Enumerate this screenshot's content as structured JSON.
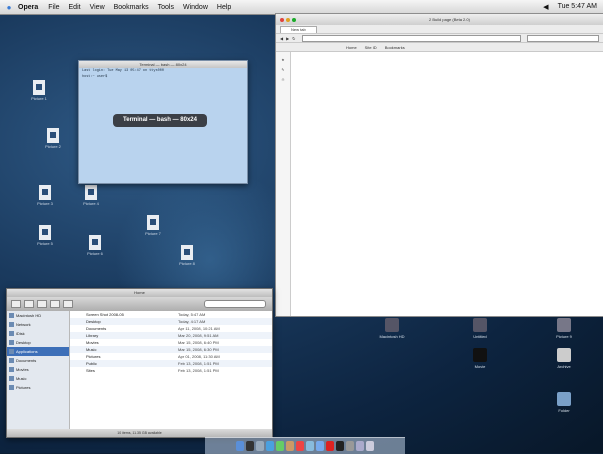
{
  "menubar": {
    "app": "Opera",
    "items": [
      "File",
      "Edit",
      "View",
      "Bookmarks",
      "Tools",
      "Window",
      "Help"
    ],
    "clock": "Tue 5:47 AM"
  },
  "terminal": {
    "title": "Terminal — bash — 80x24",
    "hud": "Terminal — bash — 80x24"
  },
  "browser": {
    "title": "2 Build page (Beta 2.0)",
    "tab": "New tab",
    "bookmarks": [
      "Home",
      "Site ID",
      "Bookmarks"
    ]
  },
  "finder": {
    "sidebar": [
      "Macintosh HD",
      "Network",
      "iDisk",
      "Desktop",
      "Applications",
      "Documents",
      "Movies",
      "Music",
      "Pictures"
    ],
    "selected": "Applications",
    "rows": [
      {
        "name": "Screen Shot 2008-05",
        "date": "Today, 5:47 AM"
      },
      {
        "name": "Desktop",
        "date": "Today, 4:17 AM"
      },
      {
        "name": "Documents",
        "date": "Apr 11, 2008, 10:21 AM"
      },
      {
        "name": "Library",
        "date": "Mar 20, 2008, 9:51 AM"
      },
      {
        "name": "Movies",
        "date": "Mar 15, 2008, 6:40 PM"
      },
      {
        "name": "Music",
        "date": "Mar 15, 2008, 6:30 PM"
      },
      {
        "name": "Pictures",
        "date": "Apr 01, 2008, 11:30 AM"
      },
      {
        "name": "Public",
        "date": "Feb 13, 2008, 1:51 PM"
      },
      {
        "name": "Sites",
        "date": "Feb 13, 2008, 1:51 PM"
      }
    ],
    "status": "10 items, 11.35 GB available"
  },
  "desktop_icons": {
    "left": [
      "Picture 1",
      "Picture 2",
      "Picture 3",
      "Picture 4",
      "Picture 5",
      "Picture 6",
      "Picture 7",
      "Picture 8"
    ],
    "right": [
      "Macintosh HD",
      "Untitled",
      "Picture 9",
      "Movie",
      "Archive",
      "Folder"
    ]
  }
}
